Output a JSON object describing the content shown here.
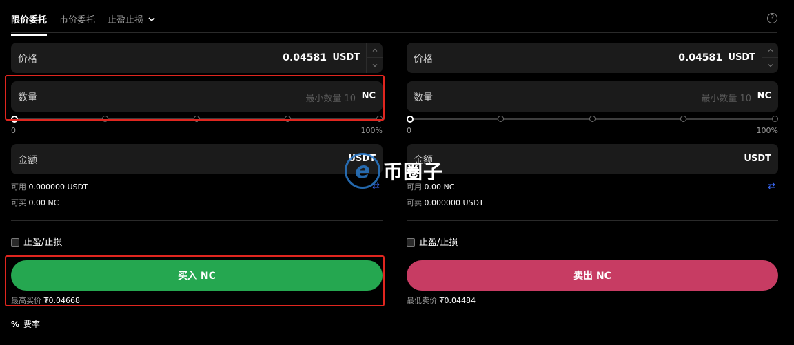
{
  "tabs": {
    "limit": "限价委托",
    "market": "市价委托",
    "tpsl": "止盈止损",
    "help": "?"
  },
  "buy": {
    "price_label": "价格",
    "price_value": "0.04581",
    "price_unit": "USDT",
    "qty_label": "数量",
    "qty_placeholder": "最小数量 10",
    "qty_unit": "NC",
    "slider_min": "0",
    "slider_max": "100%",
    "slider_value_percent": 0,
    "amount_label": "金额",
    "amount_unit": "USDT",
    "avail_label": "可用",
    "avail_value": "0.000000 USDT",
    "can_label": "可买",
    "can_value": "0.00 NC",
    "tpsl_label": "止盈/止损",
    "action_label": "买入 NC",
    "best_label": "最高买价",
    "best_value": "₮0.04668"
  },
  "sell": {
    "price_label": "价格",
    "price_value": "0.04581",
    "price_unit": "USDT",
    "qty_label": "数量",
    "qty_placeholder": "最小数量 10",
    "qty_unit": "NC",
    "slider_min": "0",
    "slider_max": "100%",
    "slider_value_percent": 0,
    "amount_label": "金额",
    "amount_unit": "USDT",
    "avail_label": "可用",
    "avail_value": "0.00 NC",
    "can_label": "可卖",
    "can_value": "0.000000 USDT",
    "tpsl_label": "止盈/止损",
    "action_label": "卖出 NC",
    "best_label": "最低卖价",
    "best_value": "₮0.04484"
  },
  "fee": {
    "icon": "%",
    "label": "费率"
  },
  "watermark": {
    "text": "币圈子"
  },
  "colors": {
    "buy": "#25a750",
    "sell": "#c73c63",
    "highlight": "#e0261f",
    "swap": "#3b6cff"
  }
}
